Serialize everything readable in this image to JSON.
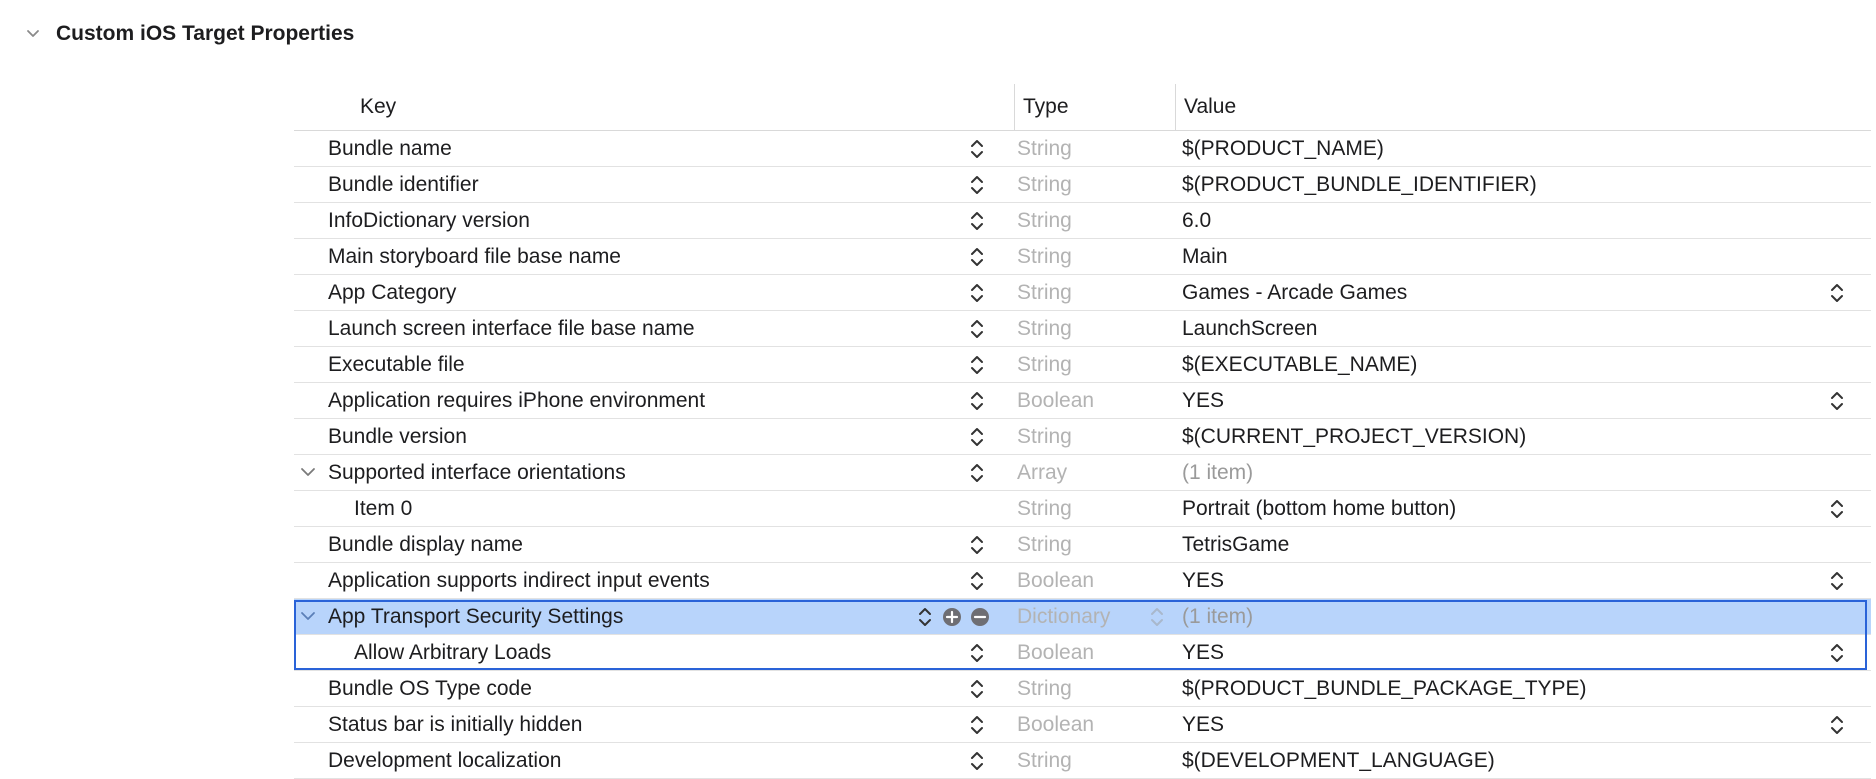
{
  "section": {
    "title": "Custom iOS Target Properties"
  },
  "columns": {
    "key": "Key",
    "type": "Type",
    "value": "Value"
  },
  "rows": [
    {
      "key": "Bundle name",
      "type": "String",
      "value": "$(PRODUCT_NAME)"
    },
    {
      "key": "Bundle identifier",
      "type": "String",
      "value": "$(PRODUCT_BUNDLE_IDENTIFIER)"
    },
    {
      "key": "InfoDictionary version",
      "type": "String",
      "value": "6.0"
    },
    {
      "key": "Main storyboard file base name",
      "type": "String",
      "value": "Main"
    },
    {
      "key": "App Category",
      "type": "String",
      "value": "Games - Arcade Games"
    },
    {
      "key": "Launch screen interface file base name",
      "type": "String",
      "value": "LaunchScreen"
    },
    {
      "key": "Executable file",
      "type": "String",
      "value": "$(EXECUTABLE_NAME)"
    },
    {
      "key": "Application requires iPhone environment",
      "type": "Boolean",
      "value": "YES"
    },
    {
      "key": "Bundle version",
      "type": "String",
      "value": "$(CURRENT_PROJECT_VERSION)"
    },
    {
      "key": "Supported interface orientations",
      "type": "Array",
      "value": "(1 item)"
    },
    {
      "key": "Item 0",
      "type": "String",
      "value": "Portrait (bottom home button)"
    },
    {
      "key": "Bundle display name",
      "type": "String",
      "value": "TetrisGame"
    },
    {
      "key": "Application supports indirect input events",
      "type": "Boolean",
      "value": "YES"
    },
    {
      "key": "App Transport Security Settings",
      "type": "Dictionary",
      "value": "(1 item)"
    },
    {
      "key": "Allow Arbitrary Loads",
      "type": "Boolean",
      "value": "YES"
    },
    {
      "key": "Bundle OS Type code",
      "type": "String",
      "value": "$(PRODUCT_BUNDLE_PACKAGE_TYPE)"
    },
    {
      "key": "Status bar is initially hidden",
      "type": "Boolean",
      "value": "YES"
    },
    {
      "key": "Development localization",
      "type": "String",
      "value": "$(DEVELOPMENT_LANGUAGE)"
    }
  ],
  "colors": {
    "selection": "#b8d4fb",
    "selection_border": "#2a63d8",
    "dim_text": "#b3b3b3"
  }
}
